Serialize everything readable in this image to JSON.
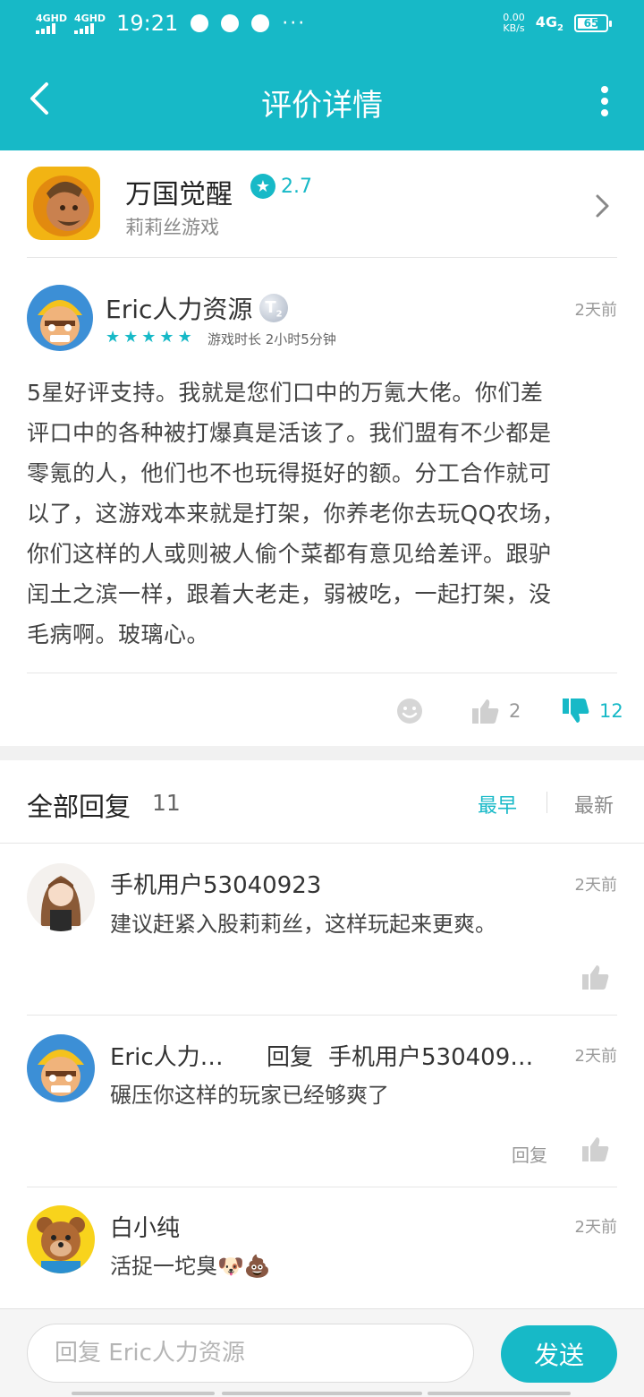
{
  "status_bar": {
    "signal_1": "4GHD",
    "signal_2": "4GHD",
    "time": "19:21",
    "dots": "···",
    "net_speed_value": "0.00",
    "net_speed_unit": "KB/s",
    "network": "4G",
    "network_sub": "2",
    "battery": "65"
  },
  "header": {
    "title": "评价详情"
  },
  "game": {
    "name": "万国觉醒",
    "rating": "2.7",
    "developer": "莉莉丝游戏"
  },
  "review": {
    "author": "Eric人力资源",
    "badge": "T",
    "badge_sub": "2",
    "time": "2天前",
    "stars": [
      "★",
      "★",
      "★",
      "★",
      "★"
    ],
    "play_time": "游戏时长 2小时5分钟",
    "body_lines": [
      "5星好评支持。我就是您们口中的万氪大佬。你们差",
      "评口中的各种被打爆真是活该了。我们盟有不少都是",
      "零氪的人，他们也不也玩得挺好的额。分工合作就可",
      "以了，这游戏本来就是打架，你养老你去玩QQ农场，",
      "你们这样的人或则被人偷个菜都有意见给差评。跟驴",
      "闰土之滨一样，跟着大老走，弱被吃，一起打架，没",
      "毛病啊。玻璃心。"
    ],
    "likes": "2",
    "dislikes": "12"
  },
  "replies": {
    "header": "全部回复",
    "count": "11",
    "sort_early": "最早",
    "sort_new": "最新",
    "items": [
      {
        "name": "手机用户53040923",
        "time": "2天前",
        "text": "建议赶紧入股莉莉丝，这样玩起来更爽。"
      },
      {
        "name": "Eric人力…",
        "reply_label": "回复",
        "reply_to": "手机用户530409…",
        "time": "2天前",
        "text": "碾压你这样的玩家已经够爽了",
        "action": "回复"
      },
      {
        "name": "白小纯",
        "time": "2天前",
        "text": "活捉一坨臭🐶💩"
      }
    ]
  },
  "bottom": {
    "placeholder": "回复 Eric人力资源",
    "send": "发送"
  },
  "colors": {
    "accent": "#17b9c7",
    "background": "#ffffff"
  }
}
